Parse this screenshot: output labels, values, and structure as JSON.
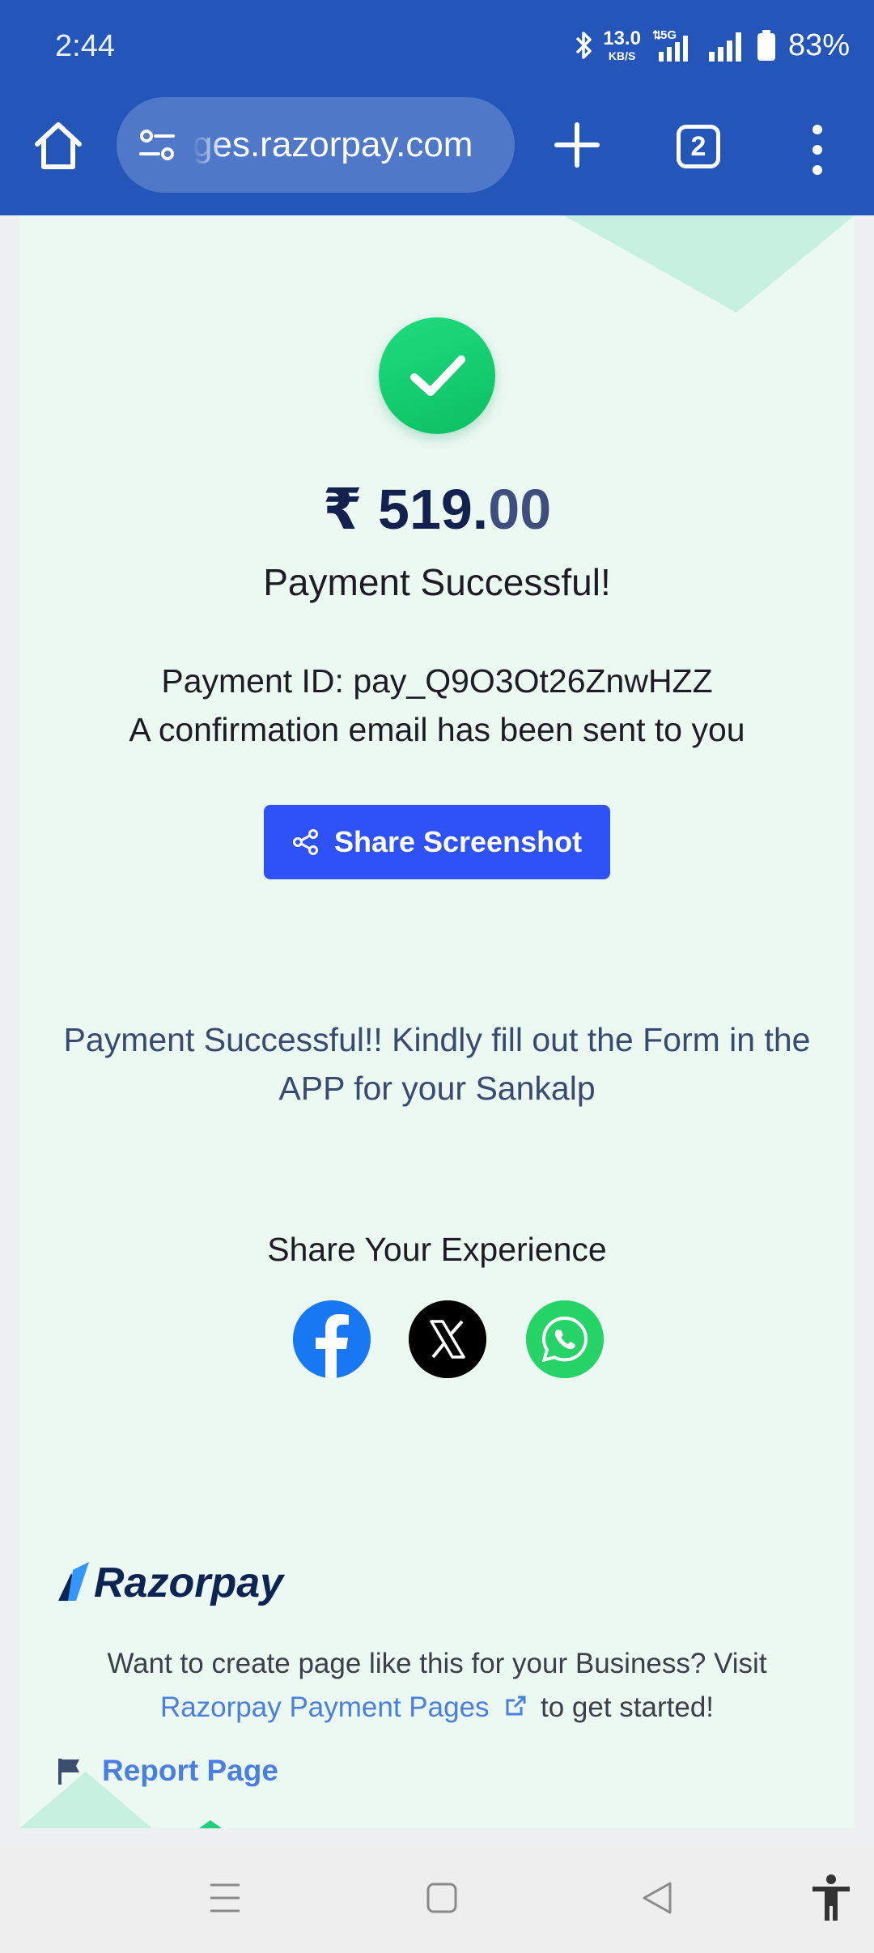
{
  "status_bar": {
    "time": "2:44",
    "net_speed_value": "13.0",
    "net_speed_unit": "KB/S",
    "network_type": "5G",
    "battery_percent": "83%"
  },
  "browser": {
    "url": "ges.razorpay.com",
    "tab_count": "2"
  },
  "payment": {
    "amount_main": "₹ 519.",
    "amount_decimal": "00",
    "status": "Payment Successful!",
    "payment_id": "Payment ID: pay_Q9O3Ot26ZnwHZZ",
    "confirmation": "A confirmation email has been sent to you",
    "share_button": "Share Screenshot"
  },
  "custom_message": "Payment Successful!! Kindly fill out the Form in the APP for your Sankalp",
  "share": {
    "title": "Share Your Experience"
  },
  "footer": {
    "brand": "Razorpay",
    "promo_text": "Want to create page like this for your Business? Visit",
    "promo_link": "Razorpay Payment Pages",
    "promo_suffix": "to get started!",
    "report": "Report Page"
  },
  "colors": {
    "browser_bar": "#2356b8",
    "page_bg": "#ecf8f2",
    "success_green": "#13c96e",
    "primary_button": "#2e52f7",
    "link": "#4a7fe0"
  },
  "icons": [
    "home-icon",
    "site-settings-icon",
    "plus-icon",
    "tabs-icon",
    "overflow-menu-icon",
    "checkmark-icon",
    "share-icon",
    "facebook-icon",
    "x-icon",
    "whatsapp-icon",
    "external-link-icon",
    "flag-icon",
    "recents-icon",
    "home-nav-icon",
    "back-icon",
    "accessibility-icon"
  ]
}
